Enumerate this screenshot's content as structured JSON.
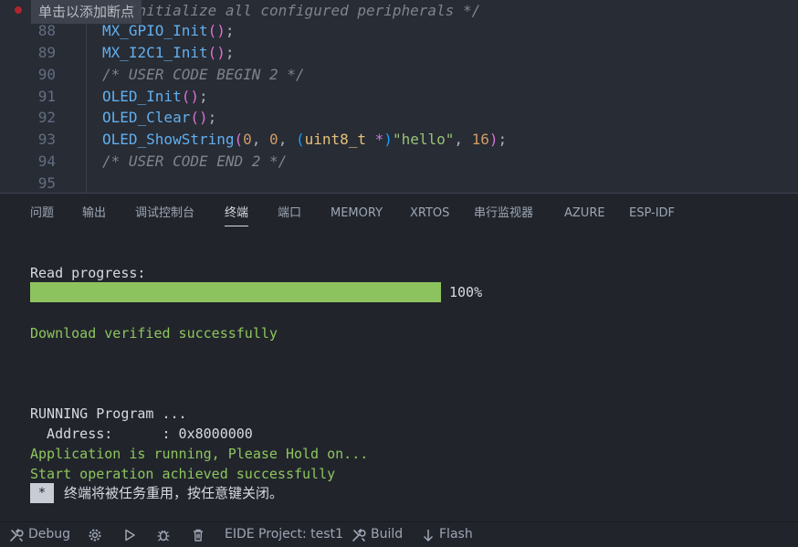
{
  "editor": {
    "breakpoint_hint": "单击以添加断点",
    "lines": [
      {
        "num": "",
        "parts": [
          {
            "t": "/* Initialize all configured peripherals */",
            "c": "tk-comment"
          }
        ]
      },
      {
        "num": "88",
        "parts": [
          {
            "t": "MX_GPIO_Init",
            "c": "tk-call"
          },
          {
            "t": "()",
            "c": "tk-paren"
          },
          {
            "t": ";",
            "c": "tk-punc"
          }
        ]
      },
      {
        "num": "89",
        "parts": [
          {
            "t": "MX_I2C1_Init",
            "c": "tk-call"
          },
          {
            "t": "()",
            "c": "tk-paren"
          },
          {
            "t": ";",
            "c": "tk-punc"
          }
        ]
      },
      {
        "num": "90",
        "parts": [
          {
            "t": "/* USER CODE BEGIN 2 */",
            "c": "tk-comment"
          }
        ]
      },
      {
        "num": "91",
        "parts": [
          {
            "t": "OLED_Init",
            "c": "tk-call"
          },
          {
            "t": "()",
            "c": "tk-paren"
          },
          {
            "t": ";",
            "c": "tk-punc"
          }
        ]
      },
      {
        "num": "92",
        "parts": [
          {
            "t": "OLED_Clear",
            "c": "tk-call"
          },
          {
            "t": "()",
            "c": "tk-paren"
          },
          {
            "t": ";",
            "c": "tk-punc"
          }
        ]
      },
      {
        "num": "93",
        "parts": [
          {
            "t": "OLED_ShowString",
            "c": "tk-call"
          },
          {
            "t": "(",
            "c": "tk-paren"
          },
          {
            "t": "0",
            "c": "tk-num"
          },
          {
            "t": ", ",
            "c": "tk-punc"
          },
          {
            "t": "0",
            "c": "tk-num"
          },
          {
            "t": ", ",
            "c": "tk-punc"
          },
          {
            "t": "(",
            "c": "tk-paren2"
          },
          {
            "t": "uint8_t",
            "c": "tk-type"
          },
          {
            "t": " *",
            "c": "tk-kw"
          },
          {
            "t": ")",
            "c": "tk-paren2"
          },
          {
            "t": "\"hello\"",
            "c": "tk-str"
          },
          {
            "t": ", ",
            "c": "tk-punc"
          },
          {
            "t": "16",
            "c": "tk-num"
          },
          {
            "t": ")",
            "c": "tk-paren"
          },
          {
            "t": ";",
            "c": "tk-punc"
          }
        ]
      },
      {
        "num": "94",
        "parts": [
          {
            "t": "/* USER CODE END 2 */",
            "c": "tk-comment"
          }
        ]
      },
      {
        "num": "95",
        "parts": []
      }
    ]
  },
  "panel": {
    "tabs": [
      "问题",
      "输出",
      "调试控制台",
      "终端",
      "端口",
      "MEMORY",
      "XRTOS",
      "串行监视器",
      "AZURE",
      "ESP-IDF"
    ],
    "active_tab": "终端",
    "terminal": {
      "read_progress_label": "Read progress:",
      "progress_value": 1.0,
      "progress_text": "100%",
      "download_verified": "Download verified successfully",
      "running_program": "RUNNING Program ...",
      "address_line": "  Address:      : 0x8000000",
      "app_running": "Application is running, Please Hold on...",
      "start_ok": "Start operation achieved successfully",
      "star": "*",
      "reuse_message": "终端将被任务重用，按任意键关闭。"
    }
  },
  "statusbar": {
    "debug": "Debug",
    "project": "EIDE Project: test1",
    "build": "Build",
    "flash": "Flash"
  },
  "colors": {
    "progress_fill": "#8dc35e",
    "success_text": "#8fc55f"
  }
}
